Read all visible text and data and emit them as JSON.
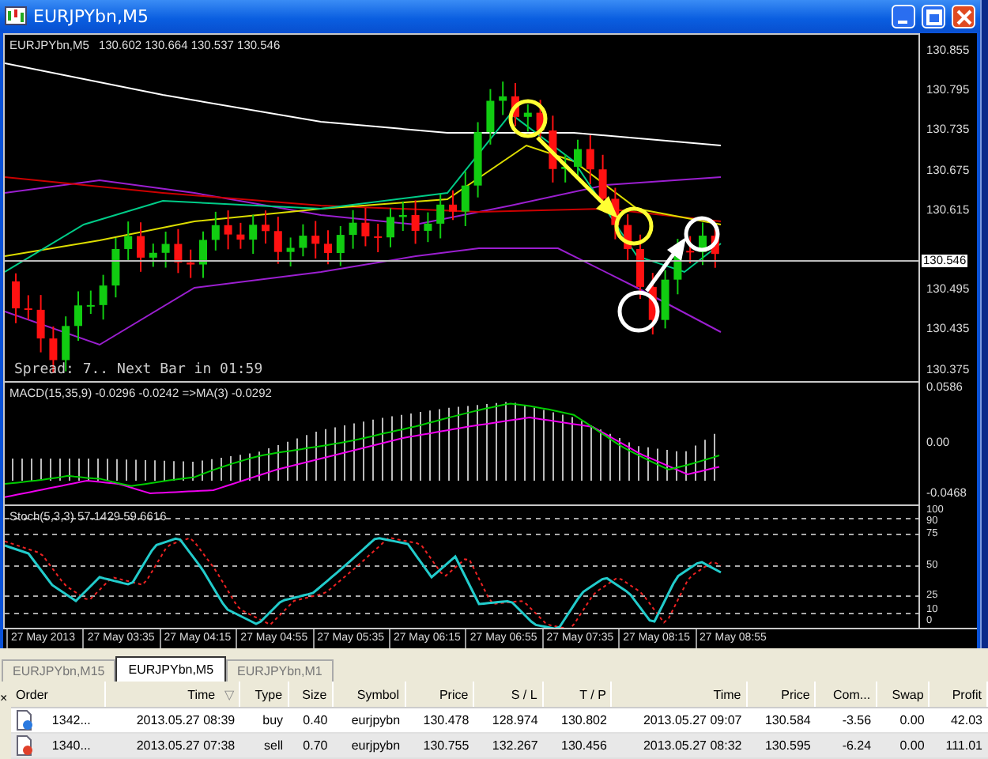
{
  "window": {
    "title": "EURJPYbn,M5"
  },
  "chart": {
    "symbol": "EURJPYbn,M5",
    "ohlc": "130.602 130.664 130.537 130.546",
    "info": "Spread: 7.. Next Bar in 01:59",
    "price_axis": [
      {
        "label": "130.855",
        "kind": "tick"
      },
      {
        "label": "130.795",
        "kind": "tick"
      },
      {
        "label": "130.735",
        "kind": "tick"
      },
      {
        "label": "130.675",
        "kind": "tick"
      },
      {
        "label": "130.615",
        "kind": "tick"
      },
      {
        "label": "130.546",
        "kind": "current"
      },
      {
        "label": "130.495",
        "kind": "tick"
      },
      {
        "label": "130.435",
        "kind": "tick"
      },
      {
        "label": "130.375",
        "kind": "tick"
      }
    ]
  },
  "macd": {
    "label": "MACD(15,35,9) -0.0296 -0.0242  =>MA(3) -0.0292",
    "axis": [
      "0.0586",
      "0.00",
      "-0.0468"
    ]
  },
  "stoch": {
    "label": "Stoch(5,3,3) 57.1429 59.6616",
    "axis": [
      "100",
      "90",
      "75",
      "50",
      "25",
      "10",
      "0"
    ]
  },
  "time_axis": [
    "27 May 2013",
    "27 May 03:35",
    "27 May 04:15",
    "27 May 04:55",
    "27 May 05:35",
    "27 May 06:15",
    "27 May 06:55",
    "27 May 07:35",
    "27 May 08:15",
    "27 May 08:55"
  ],
  "tabs": [
    {
      "label": "EURJPYbn,M15",
      "selected": false
    },
    {
      "label": "EURJPYbn,M5",
      "selected": true
    },
    {
      "label": "EURJPYbn,M1",
      "selected": false
    }
  ],
  "terminal": {
    "close": "×",
    "columns": [
      "Order",
      "Time",
      "Type",
      "Size",
      "Symbol",
      "Price",
      "S / L",
      "T / P",
      "Time",
      "Price",
      "Com...",
      "Swap",
      "Profit"
    ],
    "sort_mark": "▽",
    "rows": [
      {
        "kind": "buy",
        "cells": [
          "1342...",
          "2013.05.27 08:39",
          "buy",
          "0.40",
          "eurjpybn",
          "130.478",
          "128.974",
          "130.802",
          "2013.05.27 09:07",
          "130.584",
          "-3.56",
          "0.00",
          "42.03"
        ]
      },
      {
        "kind": "sell",
        "cells": [
          "1340...",
          "2013.05.27 07:38",
          "sell",
          "0.70",
          "eurjpybn",
          "130.755",
          "132.267",
          "130.456",
          "2013.05.27 08:32",
          "130.595",
          "-6.24",
          "0.00",
          "111.01"
        ]
      }
    ]
  }
}
